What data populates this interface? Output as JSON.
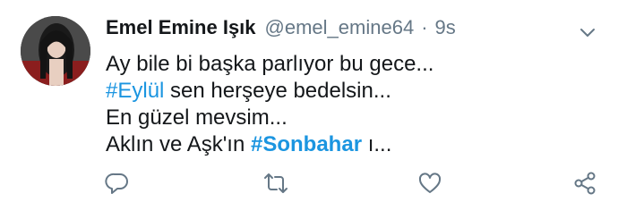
{
  "tweet": {
    "author_name": "Emel Emine Işık",
    "handle": "@emel_emine64",
    "separator": "·",
    "time": "9s",
    "lines": [
      {
        "text": "Ay bile bi başka parlıyor bu gece..."
      },
      {
        "hashtag": "#Eylül",
        "text": " sen herşeye bedelsin..."
      },
      {
        "text": "En güzel mevsim..."
      },
      {
        "prefix": "Aklın ve Aşk'ın ",
        "hashtag": "#Sonbahar",
        "suffix": " ı..."
      }
    ]
  },
  "icons": {
    "caret": "chevron-down-icon",
    "reply": "reply-icon",
    "retweet": "retweet-icon",
    "like": "heart-icon",
    "share": "share-icon"
  },
  "colors": {
    "hashtag": "#1b95e0",
    "muted": "#657786",
    "text": "#14171a"
  }
}
